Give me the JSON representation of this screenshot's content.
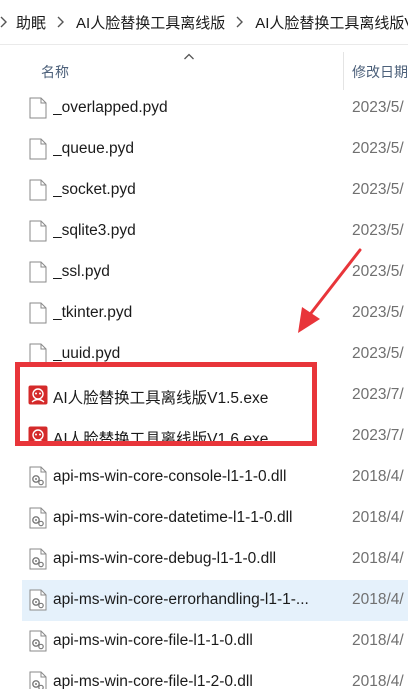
{
  "breadcrumb": {
    "items": [
      "助眠",
      "AI人脸替换工具离线版",
      "AI人脸替换工具离线版V"
    ]
  },
  "headers": {
    "name": "名称",
    "date_modified": "修改日期"
  },
  "files": [
    {
      "name": "_overlapped.pyd",
      "date": "2023/5/",
      "icon": "file-icon"
    },
    {
      "name": "_queue.pyd",
      "date": "2023/5/",
      "icon": "file-icon"
    },
    {
      "name": "_socket.pyd",
      "date": "2023/5/",
      "icon": "file-icon"
    },
    {
      "name": "_sqlite3.pyd",
      "date": "2023/5/",
      "icon": "file-icon"
    },
    {
      "name": "_ssl.pyd",
      "date": "2023/5/",
      "icon": "file-icon"
    },
    {
      "name": "_tkinter.pyd",
      "date": "2023/5/",
      "icon": "file-icon"
    },
    {
      "name": "_uuid.pyd",
      "date": "2023/5/",
      "icon": "file-icon"
    },
    {
      "name": "AI人脸替换工具离线版V1.5.exe",
      "date": "2023/7/",
      "icon": "app-icon"
    },
    {
      "name": "AI人脸替换工具离线版V1.6.exe",
      "date": "2023/7/",
      "icon": "app-icon"
    },
    {
      "name": "api-ms-win-core-console-l1-1-0.dll",
      "date": "2018/4/",
      "icon": "dll-icon"
    },
    {
      "name": "api-ms-win-core-datetime-l1-1-0.dll",
      "date": "2018/4/",
      "icon": "dll-icon"
    },
    {
      "name": "api-ms-win-core-debug-l1-1-0.dll",
      "date": "2018/4/",
      "icon": "dll-icon"
    },
    {
      "name": "api-ms-win-core-errorhandling-l1-1-...",
      "date": "2018/4/",
      "icon": "dll-icon"
    },
    {
      "name": "api-ms-win-core-file-l1-1-0.dll",
      "date": "2018/4/",
      "icon": "dll-icon"
    },
    {
      "name": "api-ms-win-core-file-l1-2-0.dll",
      "date": "2018/4/",
      "icon": "dll-icon"
    }
  ],
  "selected_index": 12,
  "colors": {
    "highlight_border": "#e8353a",
    "arrow": "#e8353a",
    "selected_row": "#e5f1fb",
    "header_text": "#4c607a",
    "date_text": "#707070"
  }
}
